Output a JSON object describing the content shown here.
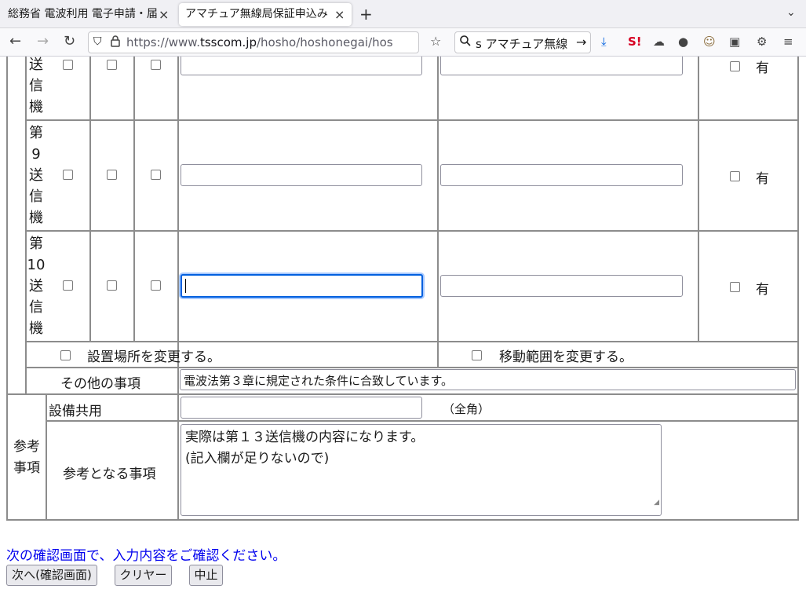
{
  "browser": {
    "tabs": [
      {
        "label": "総務省 電波利用 電子申請・届",
        "active": false
      },
      {
        "label": "アマチュア無線局保証申込み",
        "active": true
      }
    ],
    "url_prefix": "https://www.",
    "url_host": "tsscom.jp",
    "url_path": "/hosho/hoshonegai/hos",
    "search_text": "s アマチュア無線"
  },
  "icons": {
    "back": "back-arrow-icon",
    "forward": "forward-arrow-icon",
    "reload": "reload-icon",
    "shield": "tracking-protection-icon",
    "lock": "lock-icon",
    "bookmark": "bookmark-star-icon",
    "search": "search-icon",
    "download": "download-icon"
  },
  "form": {
    "transmitters": [
      {
        "chars": [
          "送",
          "信",
          "機"
        ],
        "has_label": "有"
      },
      {
        "chars": [
          "第",
          "9",
          "送",
          "信",
          "機"
        ],
        "has_label": "有"
      },
      {
        "chars": [
          "第",
          "10",
          "送",
          "信",
          "機"
        ],
        "has_label": "有"
      }
    ],
    "change_location_label": "設置場所を変更する。",
    "change_range_label": "移動範囲を変更する。",
    "other_matters_label": "その他の事項",
    "other_matters_value": "電波法第３章に規定された条件に合致しています。",
    "reference_label": "参考\n事項",
    "equipment_sharing_label": "設備共用",
    "equipment_sharing_hint": "（全角）",
    "reference_matters_label": "参考となる事項",
    "reference_matters_value": "実際は第１３送信機の内容になります。\n(記入欄が足りないので)"
  },
  "notice": "次の確認画面で、入力内容をご確認ください。",
  "buttons": {
    "next": "次へ(確認画面)",
    "clear": "クリヤー",
    "cancel": "中止"
  }
}
